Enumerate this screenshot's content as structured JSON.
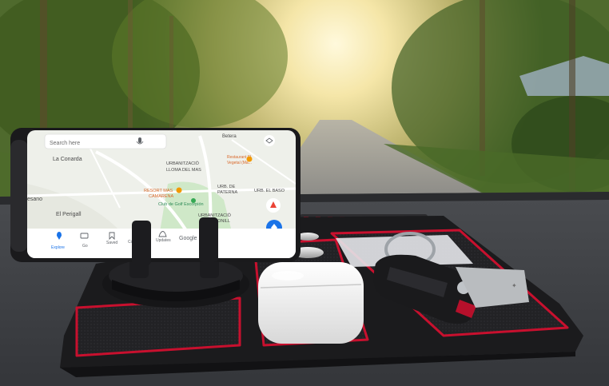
{
  "map": {
    "search_placeholder": "Search here",
    "places": {
      "la_conarda": "La Conarda",
      "betera": "Betera",
      "urbanitzacio_lloma": "URBANITZACIÓ",
      "lloma_del_mas": "LLOMA DEL MAS",
      "resort": "RESORT MAS",
      "camarena": "CAMARENA",
      "club_golf": "Club de Golf Escorpión",
      "urb_paterna_1": "URB. DE",
      "urb_paterna_2": "PATERNA",
      "urb_el_baso": "URB. EL BASO",
      "urbanitzacio_sant": "URBANITZACIÓ",
      "sant_conill": "SANT CONILL",
      "el_perigall": "El Perigall",
      "esano": "esano",
      "restaurant": "Restaurant El",
      "restaurant2": "Vegetal (Ma...",
      "google": "Google"
    },
    "nav": [
      {
        "label": "Explore"
      },
      {
        "label": "Go"
      },
      {
        "label": "Saved"
      },
      {
        "label": "Co"
      },
      {
        "label": "Updates"
      }
    ]
  },
  "colors": {
    "accent": "#1a73e8",
    "pad_outline": "#c8102e",
    "pad_black": "#1b1b1d"
  }
}
